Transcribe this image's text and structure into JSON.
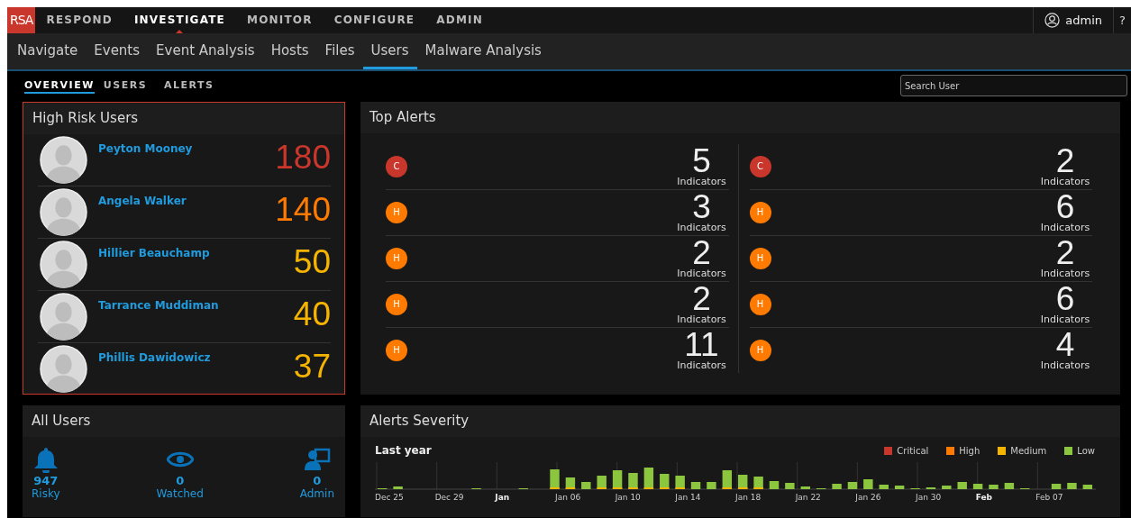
{
  "top_nav": {
    "logo": "RSA",
    "items": [
      {
        "label": "RESPOND",
        "selected": false
      },
      {
        "label": "INVESTIGATE",
        "selected": true
      },
      {
        "label": "MONITOR",
        "selected": false
      },
      {
        "label": "CONFIGURE",
        "selected": false
      },
      {
        "label": "ADMIN",
        "selected": false
      }
    ],
    "user": "admin",
    "help": "?"
  },
  "sub_nav": [
    {
      "label": "Navigate",
      "selected": false
    },
    {
      "label": "Events",
      "selected": false
    },
    {
      "label": "Event Analysis",
      "selected": false
    },
    {
      "label": "Hosts",
      "selected": false
    },
    {
      "label": "Files",
      "selected": false
    },
    {
      "label": "Users",
      "selected": true
    },
    {
      "label": "Malware Analysis",
      "selected": false
    }
  ],
  "tabs": [
    {
      "label": "OVERVIEW",
      "selected": true
    },
    {
      "label": "USERS",
      "selected": false
    },
    {
      "label": "ALERTS",
      "selected": false
    }
  ],
  "search": {
    "placeholder": "Search User"
  },
  "high_risk_users": {
    "title": "High Risk Users",
    "users": [
      {
        "name": "Peyton Mooney",
        "score": "180",
        "color": "#c9372c"
      },
      {
        "name": "Angela Walker",
        "score": "140",
        "color": "#ff7a00"
      },
      {
        "name": "Hillier Beauchamp",
        "score": "50",
        "color": "#f5b400"
      },
      {
        "name": "Tarrance Muddiman",
        "score": "40",
        "color": "#f5b400"
      },
      {
        "name": "Phillis Dawidowicz",
        "score": "37",
        "color": "#f5b400"
      }
    ]
  },
  "top_alerts": {
    "title": "Top Alerts",
    "columns": [
      [
        {
          "kind": "critical",
          "severity": "C",
          "count": "5",
          "unit": "Indicators"
        },
        {
          "kind": "high",
          "severity": "H",
          "count": "3",
          "unit": "Indicators"
        },
        {
          "kind": "high",
          "severity": "H",
          "count": "2",
          "unit": "Indicators"
        },
        {
          "kind": "high",
          "severity": "H",
          "count": "2",
          "unit": "Indicators"
        },
        {
          "kind": "high",
          "severity": "H",
          "count": "11",
          "unit": "Indicators"
        }
      ],
      [
        {
          "kind": "critical",
          "severity": "C",
          "count": "2",
          "unit": "Indicators"
        },
        {
          "kind": "high",
          "severity": "H",
          "count": "6",
          "unit": "Indicators"
        },
        {
          "kind": "high",
          "severity": "H",
          "count": "2",
          "unit": "Indicators"
        },
        {
          "kind": "high",
          "severity": "H",
          "count": "6",
          "unit": "Indicators"
        },
        {
          "kind": "high",
          "severity": "H",
          "count": "4",
          "unit": "Indicators"
        }
      ]
    ]
  },
  "all_users": {
    "title": "All Users",
    "stats": [
      {
        "kind": "bell",
        "value": "947",
        "label": "Risky"
      },
      {
        "kind": "eye",
        "value": "0",
        "label": "Watched"
      },
      {
        "kind": "admin",
        "value": "0",
        "label": "Admin"
      }
    ]
  },
  "alerts_severity": {
    "title": "Alerts Severity",
    "period": "Last year",
    "legend": [
      {
        "label": "Critical",
        "color": "#c9372c"
      },
      {
        "label": "High",
        "color": "#ff7a00"
      },
      {
        "label": "Medium",
        "color": "#f5b400"
      },
      {
        "label": "Low",
        "color": "#8cc63f"
      }
    ],
    "x_labels": [
      {
        "label": "Dec 25",
        "bold": false
      },
      {
        "label": "Dec 29",
        "bold": false
      },
      {
        "label": "Jan",
        "bold": true
      },
      {
        "label": "Jan 06",
        "bold": false
      },
      {
        "label": "Jan 10",
        "bold": false
      },
      {
        "label": "Jan 14",
        "bold": false
      },
      {
        "label": "Jan 18",
        "bold": false
      },
      {
        "label": "Jan 22",
        "bold": false
      },
      {
        "label": "Jan 26",
        "bold": false
      },
      {
        "label": "Jan 30",
        "bold": false
      },
      {
        "label": "Feb",
        "bold": true
      },
      {
        "label": "Feb 07",
        "bold": false
      }
    ]
  }
}
